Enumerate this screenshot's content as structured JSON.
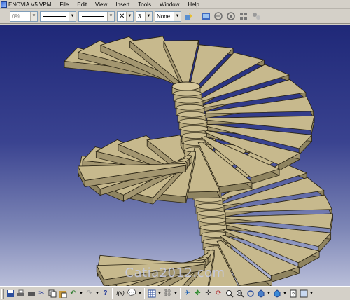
{
  "menubar": {
    "app_title": "ENOVIA V5 VPM",
    "items": [
      "File",
      "Edit",
      "View",
      "Insert",
      "Tools",
      "Window",
      "Help"
    ]
  },
  "toolbar": {
    "transparency_value": "0%",
    "line_count": "3",
    "layer_value": "None"
  },
  "viewport": {
    "watermark": "Catia2012.com",
    "colors": {
      "background_top": "#1f2878",
      "background_bottom": "#b9bed9",
      "stair_fill": "#c7b98d",
      "stair_edge": "#2a2414"
    }
  },
  "bottom_toolbar": {
    "formula_label": "f(x)"
  }
}
